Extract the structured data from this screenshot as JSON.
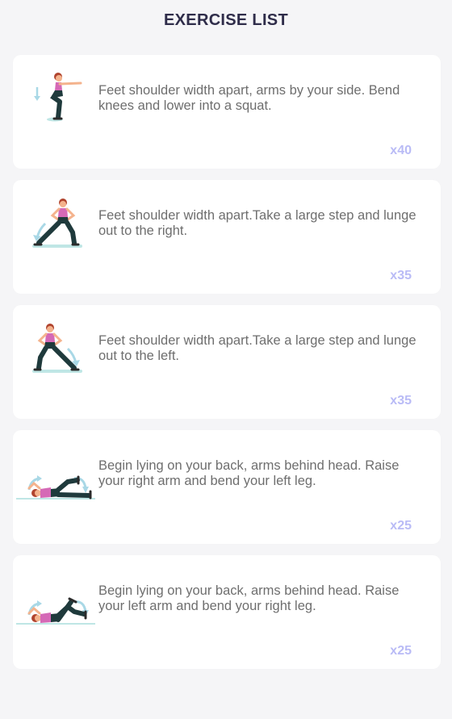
{
  "header": {
    "title": "EXERCISE LIST"
  },
  "colors": {
    "background": "#f5f5f7",
    "card": "#ffffff",
    "title_text": "#2f2d4a",
    "description_text": "#6e6e6e",
    "reps_accent": "#b9bbf6",
    "figure_skin": "#f4b38d",
    "figure_hair": "#b0442e",
    "figure_top": "#d569b6",
    "figure_pants": "#1f3a3c",
    "floor_mat": "#bfe6e5",
    "motion_arrow": "#a9d8e6"
  },
  "exercises": [
    {
      "icon": "squat-figure-icon",
      "description": "Feet shoulder width apart, arms by your side. Bend knees and lower into a squat.",
      "reps": "x40"
    },
    {
      "icon": "side-lunge-right-figure-icon",
      "description": "Feet shoulder width apart.Take a large step and lunge out to the right.",
      "reps": "x35"
    },
    {
      "icon": "side-lunge-left-figure-icon",
      "description": "Feet shoulder width apart.Take a large step and lunge out to the left.",
      "reps": "x35"
    },
    {
      "icon": "lying-crunch-right-figure-icon",
      "description": "Begin lying on your back, arms behind head. Raise your right arm and bend your left leg.",
      "reps": "x25"
    },
    {
      "icon": "lying-crunch-left-figure-icon",
      "description": "Begin lying on your back, arms behind head. Raise your left arm and bend your right leg.",
      "reps": "x25"
    }
  ]
}
